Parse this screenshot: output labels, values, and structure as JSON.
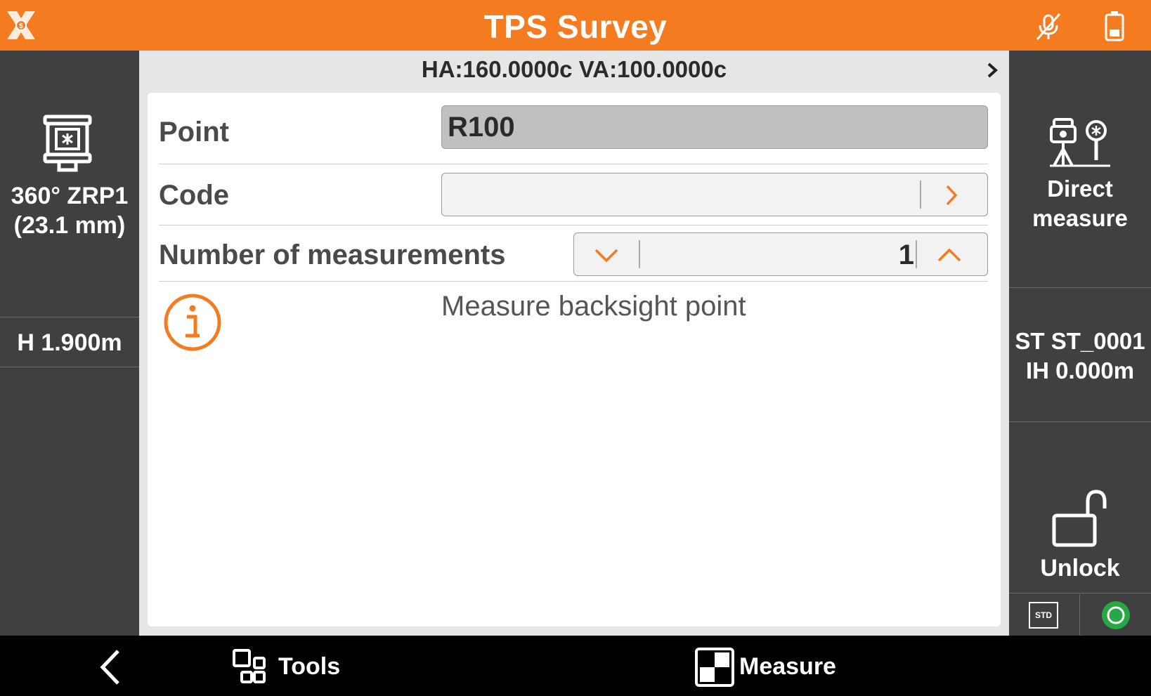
{
  "header": {
    "title": "TPS Survey"
  },
  "left_panel": {
    "prism_line1": "360° ZRP1",
    "prism_line2": "(23.1 mm)",
    "height": "H 1.900m"
  },
  "angles": {
    "text": "HA:160.0000c  VA:100.0000c"
  },
  "form": {
    "point_label": "Point",
    "point_value": "R100",
    "code_label": "Code",
    "code_value": "",
    "measurements_label": "Number of measurements",
    "measurements_value": "1",
    "info_message": "Measure backsight point"
  },
  "right_panel": {
    "direct_line1": "Direct",
    "direct_line2": "measure",
    "station_line1": "ST ST_0001",
    "station_line2": "IH 0.000m",
    "unlock_label": "Unlock",
    "std_label": "STD"
  },
  "navbar": {
    "tools_label": "Tools",
    "measure_label": "Measure"
  },
  "colors": {
    "accent": "#f47b20",
    "panel": "#404040",
    "status_ok": "#27a844"
  }
}
